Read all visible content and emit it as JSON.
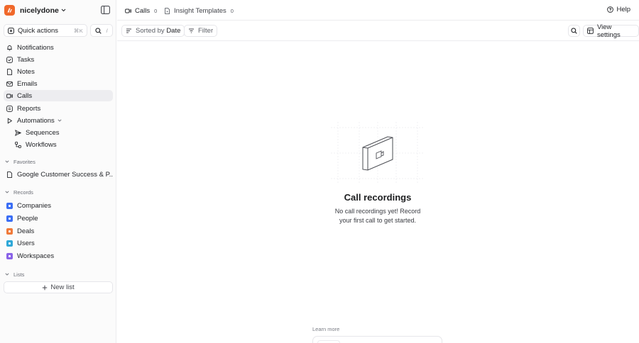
{
  "sidebar": {
    "workspace_name": "nicelydone",
    "quick_actions": {
      "label": "Quick actions",
      "shortcut": "⌘K",
      "search_shortcut": "/"
    },
    "nav": [
      {
        "label": "Notifications",
        "icon": "bell-icon"
      },
      {
        "label": "Tasks",
        "icon": "check-square-icon"
      },
      {
        "label": "Notes",
        "icon": "note-icon"
      },
      {
        "label": "Emails",
        "icon": "mail-icon"
      },
      {
        "label": "Calls",
        "icon": "video-icon",
        "active": true
      },
      {
        "label": "Reports",
        "icon": "report-icon"
      },
      {
        "label": "Automations",
        "icon": "play-icon"
      },
      {
        "label": "Sequences",
        "icon": "send-icon"
      },
      {
        "label": "Workflows",
        "icon": "workflow-icon"
      }
    ],
    "favorites": {
      "header": "Favorites",
      "items": [
        {
          "label": "Google Customer Success & P..."
        }
      ]
    },
    "records": {
      "header": "Records",
      "items": [
        {
          "label": "Companies",
          "color": "#3b6ef5"
        },
        {
          "label": "People",
          "color": "#3b6ef5"
        },
        {
          "label": "Deals",
          "color": "#f07a3a"
        },
        {
          "label": "Users",
          "color": "#2fa8d8"
        },
        {
          "label": "Workspaces",
          "color": "#8a63e8"
        }
      ]
    },
    "lists": {
      "header": "Lists",
      "new_list_label": "New list"
    }
  },
  "topbar": {
    "tabs": [
      {
        "label": "Calls",
        "count": "0"
      },
      {
        "label": "Insight Templates",
        "count": "0"
      }
    ],
    "help_label": "Help"
  },
  "toolbar": {
    "sort_prefix": "Sorted by",
    "sort_value": "Date",
    "filter_label": "Filter",
    "view_settings_label": "View settings"
  },
  "empty_state": {
    "title": "Call recordings",
    "description": "No call recordings yet! Record your first call to get started."
  },
  "learn_more": {
    "label": "Learn more"
  }
}
